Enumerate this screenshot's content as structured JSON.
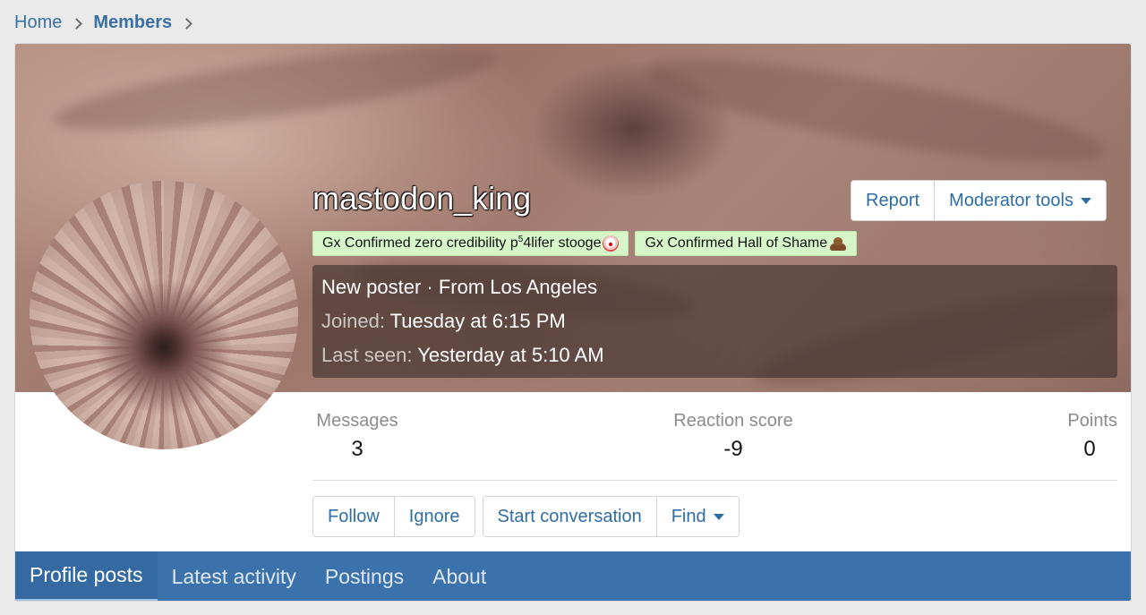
{
  "breadcrumb": {
    "home": "Home",
    "members": "Members"
  },
  "profile": {
    "username": "mastodon_king",
    "user_banners": [
      {
        "text": "Gx Confirmed zero credibility p",
        "sup": "5",
        "text_after": "4lifer stooge",
        "emoji": "clown-face"
      },
      {
        "text": "Gx Confirmed Hall of Shame",
        "emoji": "pile-of-poo"
      }
    ],
    "info": {
      "status_line": "New poster · From Los Angeles",
      "joined_label": "Joined:",
      "joined_value": "Tuesday at 6:15 PM",
      "last_seen_label": "Last seen:",
      "last_seen_value": "Yesterday at 5:10 AM"
    }
  },
  "top_actions": {
    "report": "Report",
    "moderator_tools": "Moderator tools"
  },
  "stats": {
    "messages_label": "Messages",
    "messages_value": "3",
    "reaction_label": "Reaction score",
    "reaction_value": "-9",
    "points_label": "Points",
    "points_value": "0"
  },
  "actions": {
    "follow": "Follow",
    "ignore": "Ignore",
    "start_conversation": "Start conversation",
    "find": "Find"
  },
  "tabs": [
    {
      "label": "Profile posts",
      "active": true
    },
    {
      "label": "Latest activity",
      "active": false
    },
    {
      "label": "Postings",
      "active": false
    },
    {
      "label": "About",
      "active": false
    }
  ],
  "colors": {
    "accent": "#3b72ab",
    "link": "#2f6da5",
    "banner_badge": "#d6f5c8"
  }
}
